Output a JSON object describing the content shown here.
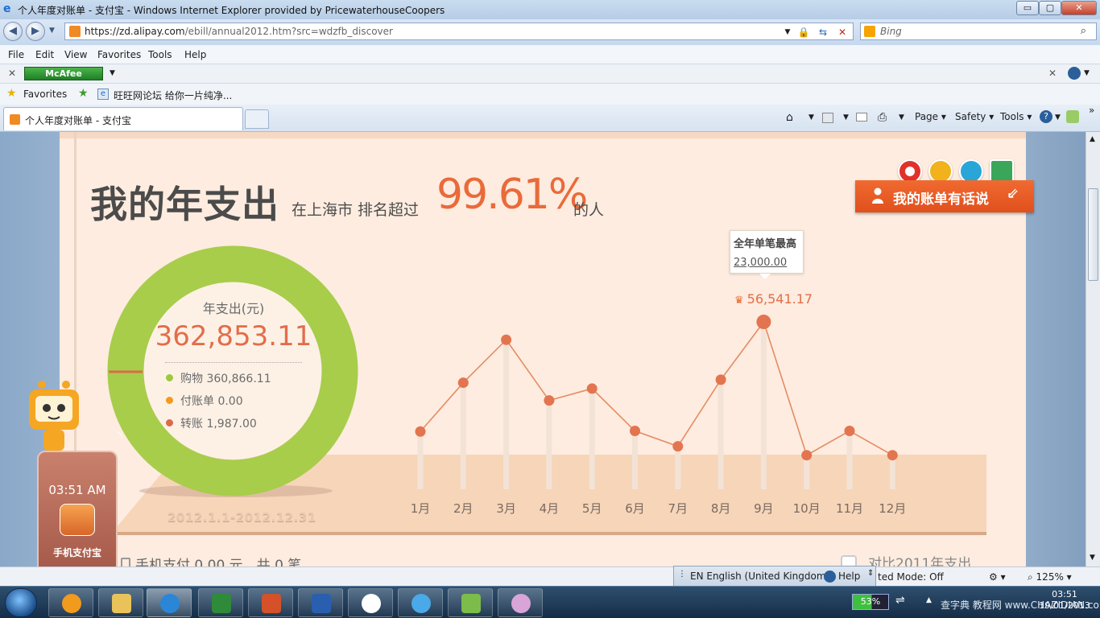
{
  "window": {
    "title": "个人年度对账单 - 支付宝 - Windows Internet Explorer provided by PricewaterhouseCoopers",
    "min_label": "▭",
    "max_label": "▢",
    "close_label": "✕"
  },
  "address": {
    "url_main": "https://zd.alipay.com",
    "url_rest": "/ebill/annual2012.htm?src=wdzfb_discover",
    "search_placeholder": "Bing"
  },
  "menu": [
    "File",
    "Edit",
    "View",
    "Favorites",
    "Tools",
    "Help"
  ],
  "mcafee": {
    "label": "McAfee"
  },
  "favorites": {
    "label": "Favorites",
    "link": "旺旺网论坛 给你一片纯净..."
  },
  "tab": {
    "label": "个人年度对账单 - 支付宝"
  },
  "commands": [
    "Page ▾",
    "Safety ▾",
    "Tools ▾"
  ],
  "page": {
    "title": "我的年支出",
    "rank_prefix": "在上海市 排名超过",
    "rank_percent": "99.61%",
    "rank_suffix": "的人",
    "banner": "我的账单有话说",
    "ring_label": "年支出(元)",
    "total": "362,853.11",
    "legend": [
      {
        "label": "购物 360,866.11",
        "color": "#9dca3c"
      },
      {
        "label": "付账单 0.00",
        "color": "#f39a1e"
      },
      {
        "label": "转账 1,987.00",
        "color": "#dd6a4a"
      }
    ],
    "date_range": "2012.1.1-2012.12.31",
    "phone_time": "03:51 AM",
    "phone_app": "手机支付宝",
    "bottom_left": "手机支付 0.00 元，共 0 笔",
    "bottom_right": "对比2011年支出"
  },
  "chart_data": {
    "type": "line",
    "categories": [
      "1月",
      "2月",
      "3月",
      "4月",
      "5月",
      "6月",
      "7月",
      "8月",
      "9月",
      "10月",
      "11月",
      "12月"
    ],
    "series": [
      {
        "values": [
          19500,
          36000,
          50500,
          30000,
          34000,
          19700,
          14500,
          37000,
          56541.17,
          11500,
          19700,
          11500
        ]
      }
    ],
    "max_label": "56,541.17",
    "max_index": 8,
    "tooltip": {
      "title": "全年单笔最高",
      "value": "23,000.00"
    }
  },
  "status": {
    "language": "EN English (United Kingdom)",
    "help": "Help",
    "protected": "ted Mode: Off",
    "zoom": "125% ▾"
  },
  "taskbar": {
    "battery": "53%",
    "time": "03:51",
    "date": "19/01/2013",
    "watermark": "查字典 教程网 www.CHAZIDIAN.com"
  }
}
